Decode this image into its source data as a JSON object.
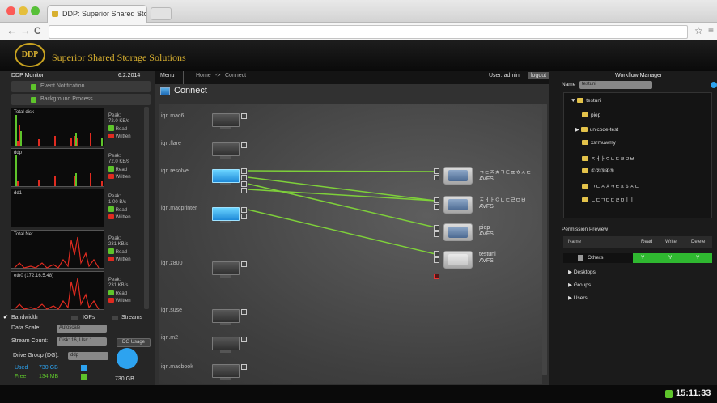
{
  "browser": {
    "tab_title": "DDP: Superior Shared Sto",
    "tab_close": "×",
    "nav_back": "←",
    "nav_forward": "→",
    "nav_reload": "C",
    "star": "☆",
    "menu": "≡"
  },
  "app": {
    "logo_text": "DDP",
    "title": "Superior Shared Storage Solutions"
  },
  "left": {
    "monitor_label": "DDP Monitor",
    "date": "6.2.2014",
    "menu": [
      "Event Notification",
      "Background Process"
    ],
    "graphs": [
      {
        "label": "Total disk",
        "peak": "Peak:",
        "rate": "72.0 KB/s",
        "read": "Read",
        "written": "Written"
      },
      {
        "label": "ddp",
        "peak": "Peak:",
        "rate": "72.0 KB/s",
        "read": "Read",
        "written": "Written"
      },
      {
        "label": "dd1",
        "peak": "Peak:",
        "rate": "1.00 B/s",
        "read": "Read",
        "written": "Written"
      },
      {
        "label": "Total Net",
        "peak": "Peak:",
        "rate": "231 KB/s",
        "read": "Read",
        "written": "Written"
      },
      {
        "label": "eth0 (172.16.5.48)",
        "peak": "Peak:",
        "rate": "231 KB/s",
        "read": "Read",
        "written": "Written"
      }
    ],
    "bandwidth_check": "✔",
    "bandwidth": "Bandwidth",
    "iops": "IOPs",
    "streams": "Streams",
    "data_scale_label": "Data Scale:",
    "data_scale_value": "Autoscale",
    "stream_count_label": "Stream Count:",
    "stream_count_value": "Disk: 16, Usr: 1",
    "dg_usage": "DG Usage",
    "drive_group_label": "Drive Group (DG):",
    "drive_group_value": "ddp",
    "used_label": "Used",
    "used_value": "730 GB",
    "free_label": "Free",
    "free_value": "134 MB",
    "total": "730 GB"
  },
  "center": {
    "menu": "Menu",
    "breadcrumb_home": "Home",
    "breadcrumb_sep": "->",
    "breadcrumb_connect": "Connect",
    "user": "User: admin",
    "logout": "logout",
    "connect_title": "Connect",
    "clients": [
      "iqn.mac6",
      "iqn.flare",
      "iqn.resolve",
      "iqn.macprinter",
      "iqn.z800",
      "iqn.suse",
      "iqn.m2",
      "iqn.macbook"
    ],
    "volumes": [
      {
        "name": "ㄱㄷㅈㅊㅋㅌㅍㅎㅅㄷ",
        "type": "AVFS"
      },
      {
        "name": "ㅈㅓㅏㅇㄴㄷㄹㅁㅂ",
        "type": "AVFS"
      },
      {
        "name": "piep",
        "type": "AVFS"
      },
      {
        "name": "testuni",
        "type": "AVFS"
      }
    ]
  },
  "right": {
    "title": "Workflow Manager",
    "name_label": "Name",
    "name_value": "testuni",
    "tree": [
      {
        "label": "testuni",
        "arrow": "▼"
      },
      {
        "label": "piep",
        "arrow": ""
      },
      {
        "label": "unicode-test",
        "arrow": "▶"
      },
      {
        "label": "хзгmuwmy",
        "arrow": ""
      },
      {
        "label": "ㅈㅓㅏㅇㄴㄷㄹㅁㅂ",
        "arrow": ""
      },
      {
        "label": "①②③④⑤",
        "arrow": ""
      },
      {
        "label": "ㄱㄷㅈㅊㅋㅌㅍㅎㅅㄷ",
        "arrow": ""
      },
      {
        "label": "ㄴㄷㄱㅁㄷㄹㅁㅣㅣ",
        "arrow": ""
      }
    ],
    "permission_title": "Permission Preview",
    "columns": [
      "Name",
      "Read",
      "Write",
      "Delete"
    ],
    "rows": [
      {
        "name": "Others",
        "read": "Y",
        "write": "Y",
        "delete": "Y"
      },
      {
        "name": "Desktops",
        "arrow": "▶"
      },
      {
        "name": "Groups",
        "arrow": "▶"
      },
      {
        "name": "Users",
        "arrow": "▶"
      }
    ]
  },
  "status": {
    "time": "15:11:33"
  },
  "colors": {
    "accent_gold": "#d8b030",
    "link_green": "#7ed03a",
    "status_red": "#e02b20",
    "active_blue": "#1e8ad8"
  }
}
